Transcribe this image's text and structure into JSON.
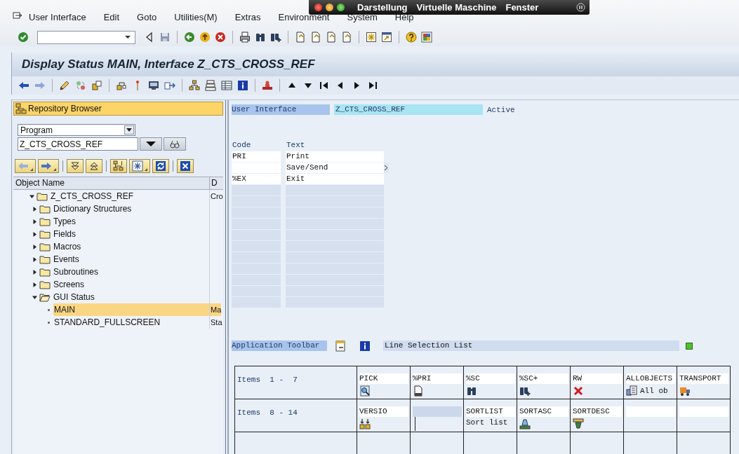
{
  "menu_bar": {
    "items": [
      "User Interface",
      "Edit",
      "Goto",
      "Utilities(M)",
      "Extras",
      "Environment",
      "System",
      "Help"
    ]
  },
  "host_bar": {
    "items": [
      "Darstellung",
      "Virtuelle Maschine",
      "Fenster"
    ]
  },
  "window": {
    "title": "Display Status MAIN, Interface Z_CTS_CROSS_REF"
  },
  "repository_browser": {
    "title": "Repository Browser",
    "object_type": "Program",
    "object_name": "Z_CTS_CROSS_REF",
    "columns": [
      "Object Name",
      "D"
    ],
    "tree": [
      {
        "label": "Z_CTS_CROSS_REF",
        "description": "Cro",
        "expanded": true,
        "selected": false,
        "children": [
          {
            "label": "Dictionary Structures",
            "expanded": false,
            "selected": false
          },
          {
            "label": "Types",
            "expanded": false,
            "selected": false
          },
          {
            "label": "Fields",
            "expanded": false,
            "selected": false
          },
          {
            "label": "Macros",
            "expanded": false,
            "selected": false
          },
          {
            "label": "Events",
            "expanded": false,
            "selected": false
          },
          {
            "label": "Subroutines",
            "expanded": false,
            "selected": false
          },
          {
            "label": "Screens",
            "expanded": false,
            "selected": false
          },
          {
            "label": "GUI Status",
            "expanded": true,
            "selected": false,
            "children": [
              {
                "label": "MAIN",
                "description": "Ma",
                "selected": true
              },
              {
                "label": "STANDARD_FULLSCREEN",
                "description": "Sta",
                "selected": false
              }
            ]
          }
        ]
      }
    ]
  },
  "interface": {
    "label": "User Interface",
    "name": "Z_CTS_CROSS_REF",
    "status": "Active"
  },
  "function_keys": {
    "columns": [
      "Code",
      "Text"
    ],
    "rows": [
      {
        "code": "PRI",
        "text": "Print",
        "submenu": false
      },
      {
        "text": "Save/Send",
        "submenu": true
      },
      {
        "code": "%EX",
        "text": "Exit",
        "submenu": false
      },
      {
        "submenu": false
      },
      {
        "submenu": false
      },
      {
        "submenu": false
      },
      {
        "submenu": false
      },
      {
        "submenu": false
      },
      {
        "submenu": false
      },
      {
        "submenu": false
      },
      {
        "submenu": false
      },
      {
        "submenu": false
      },
      {
        "submenu": false
      },
      {
        "submenu": false
      }
    ]
  },
  "application_toolbar": {
    "label": "Application Toolbar",
    "description": "Line Selection List",
    "active": true,
    "rows": [
      {
        "label": "Items  1 -  7",
        "items": [
          {
            "code": "PICK",
            "focused": false
          },
          {
            "code": "%PRI",
            "focused": false
          },
          {
            "code": "%SC",
            "focused": false
          },
          {
            "code": "%SC+",
            "focused": false
          },
          {
            "code": "RW",
            "focused": false
          },
          {
            "code": "ALLOBJECTS",
            "text": "All ob",
            "focused": false
          },
          {
            "code": "TRANSPORT",
            "focused": false
          }
        ]
      },
      {
        "label": "Items  8 - 14",
        "items": [
          {
            "code": "VERSIO",
            "focused": false
          },
          {
            "focused": true
          },
          {
            "code": "SORTLIST",
            "text": "Sort list",
            "focused": false
          },
          {
            "code": "SORTASC",
            "focused": false
          },
          {
            "code": "SORTDESC",
            "focused": false
          },
          {
            "focused": false
          },
          {
            "focused": false
          }
        ]
      }
    ]
  }
}
